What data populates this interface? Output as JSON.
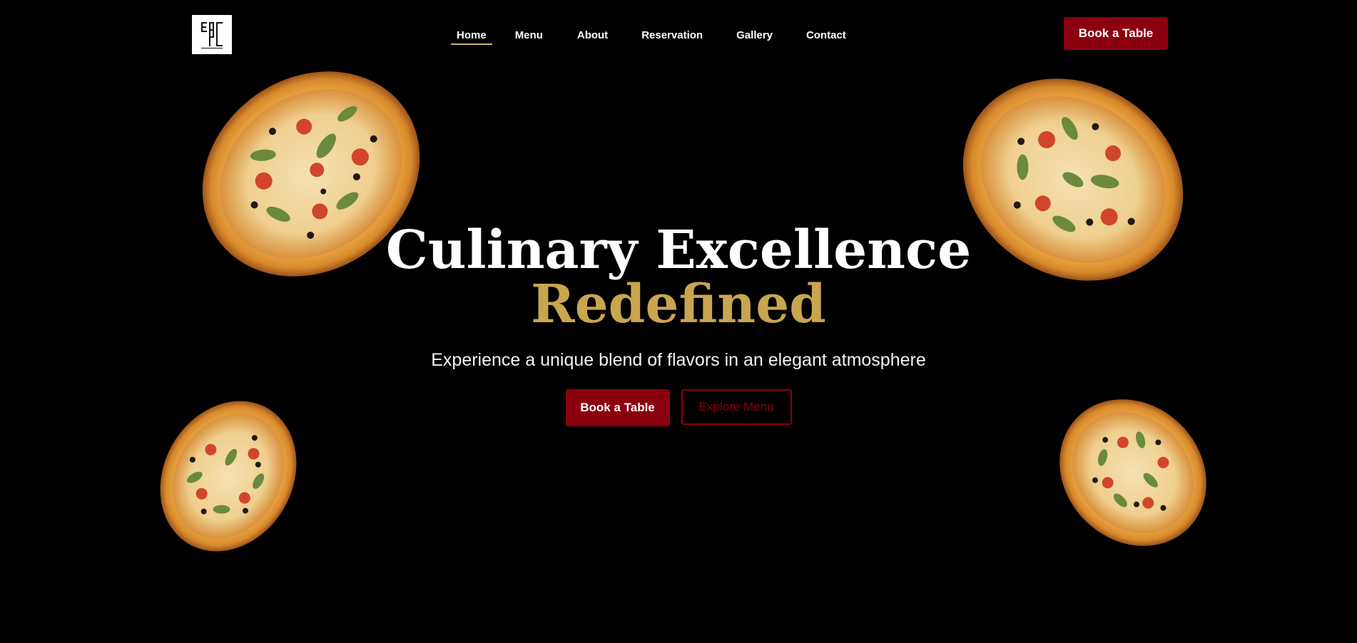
{
  "header": {
    "logo_icon": "ebc-monogram-logo-icon",
    "nav": [
      {
        "label": "Home",
        "active": true
      },
      {
        "label": "Menu",
        "active": false
      },
      {
        "label": "About",
        "active": false
      },
      {
        "label": "Reservation",
        "active": false
      },
      {
        "label": "Gallery",
        "active": false
      },
      {
        "label": "Contact",
        "active": false
      }
    ],
    "cta_label": "Book a Table"
  },
  "hero": {
    "title_line1": "Culinary Excellence",
    "title_line2": "Redefined",
    "subtitle": "Experience a unique blend of flavors in an elegant atmosphere",
    "primary_cta": "Book a Table",
    "secondary_cta": "Explore Menu"
  },
  "colors": {
    "background": "#000000",
    "accent_red": "#8b000f",
    "accent_gold": "#c9a550"
  },
  "images": [
    "pizza-image",
    "pizza-image",
    "pizza-image",
    "pizza-image"
  ]
}
